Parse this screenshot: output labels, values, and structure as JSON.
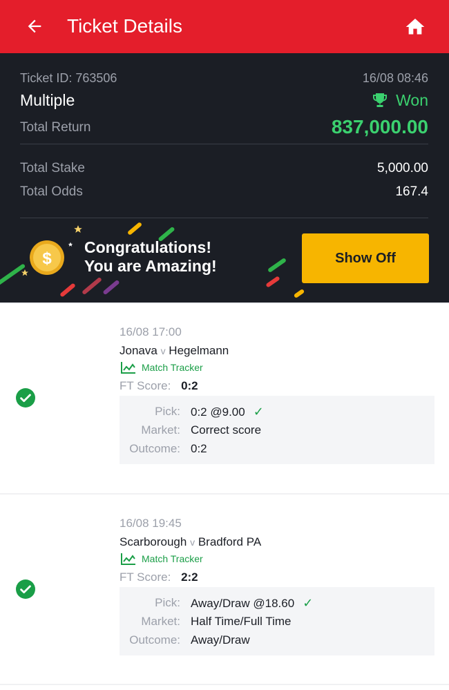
{
  "header": {
    "title": "Ticket Details",
    "back_icon": "arrow-left-icon",
    "home_icon": "home-icon",
    "bg_color": "#e41e2b"
  },
  "summary": {
    "ticket_id_label": "Ticket ID:",
    "ticket_id": "763506",
    "datetime": "16/08 08:46",
    "bet_type": "Multiple",
    "status": "Won",
    "total_return_label": "Total Return",
    "total_return": "837,000.00",
    "total_stake_label": "Total Stake",
    "total_stake": "5,000.00",
    "total_odds_label": "Total Odds",
    "total_odds": "167.4",
    "win_color": "#3bd16f"
  },
  "banner": {
    "line1": "Congratulations!",
    "line2": "You are Amazing!",
    "button_label": "Show Off",
    "button_color": "#f7b500"
  },
  "bets": [
    {
      "datetime": "16/08 17:00",
      "home": "Jonava",
      "vs": "v",
      "away": "Hegelmann",
      "tracker_label": "Match Tracker",
      "score_label": "FT Score:",
      "score": "0:2",
      "pick_label": "Pick:",
      "pick": "0:2 @9.00",
      "market_label": "Market:",
      "market": "Correct score",
      "outcome_label": "Outcome:",
      "outcome": "0:2"
    },
    {
      "datetime": "16/08 19:45",
      "home": "Scarborough",
      "vs": "v",
      "away": "Bradford PA",
      "tracker_label": "Match Tracker",
      "score_label": "FT Score:",
      "score": "2:2",
      "pick_label": "Pick:",
      "pick": "Away/Draw @18.60",
      "market_label": "Market:",
      "market": "Half Time/Full Time",
      "outcome_label": "Outcome:",
      "outcome": "Away/Draw"
    }
  ]
}
